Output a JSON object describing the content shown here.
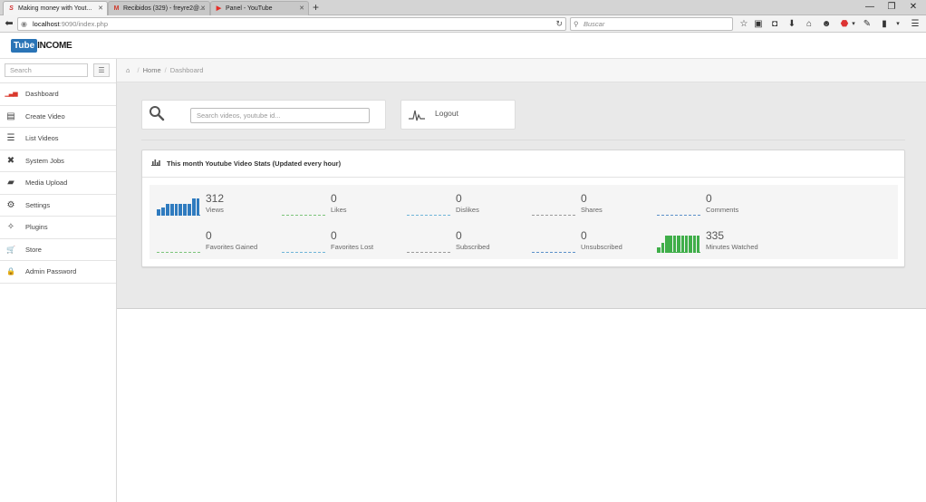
{
  "browser": {
    "tabs": [
      {
        "title": "Making money with Yout...",
        "favicon": "S",
        "active": true
      },
      {
        "title": "Recibidos (329) - freyre2@...",
        "favicon": "M",
        "active": false
      },
      {
        "title": "Panel - YouTube",
        "favicon": "▶",
        "active": false
      }
    ],
    "url_host": "localhost",
    "url_path": ":9090/index.php",
    "search_placeholder": "Buscar"
  },
  "app": {
    "logo_tube": "Tube",
    "logo_income": "INCOME"
  },
  "sidebar": {
    "search_placeholder": "Search",
    "items": [
      {
        "label": "Dashboard",
        "icon": "bar-chart-icon",
        "glyph": "▁▃▅",
        "active": true
      },
      {
        "label": "Create Video",
        "icon": "film-icon",
        "glyph": "▤"
      },
      {
        "label": "List Videos",
        "icon": "list-icon",
        "glyph": "☰"
      },
      {
        "label": "System Jobs",
        "icon": "tools-icon",
        "glyph": "✖"
      },
      {
        "label": "Media Upload",
        "icon": "folder-icon",
        "glyph": "▰"
      },
      {
        "label": "Settings",
        "icon": "gears-icon",
        "glyph": "⚙"
      },
      {
        "label": "Plugins",
        "icon": "magic-icon",
        "glyph": "✧"
      },
      {
        "label": "Store",
        "icon": "cart-icon",
        "glyph": "🛒"
      },
      {
        "label": "Admin Password",
        "icon": "lock-icon",
        "glyph": "🔒"
      }
    ]
  },
  "breadcrumb": {
    "home": "Home",
    "current": "Dashboard"
  },
  "search": {
    "placeholder": "Search videos, youtube id..."
  },
  "logout": {
    "label": "Logout"
  },
  "stats": {
    "title": "This month Youtube Video Stats (Updated every hour)",
    "items": [
      {
        "value": "312",
        "label": "Views",
        "color": "#2f7bbf",
        "bars": [
          0.35,
          0.45,
          0.65,
          0.65,
          0.65,
          0.65,
          0.65,
          0.65,
          0.95,
          0.95
        ]
      },
      {
        "value": "0",
        "label": "Likes",
        "color": "#7cc47a",
        "bars": []
      },
      {
        "value": "0",
        "label": "Dislikes",
        "color": "#6fb4d8",
        "bars": []
      },
      {
        "value": "0",
        "label": "Shares",
        "color": "#9a9a9a",
        "bars": []
      },
      {
        "value": "0",
        "label": "Comments",
        "color": "#5b90c9",
        "bars": []
      },
      {
        "value": "0",
        "label": "Favorites Gained",
        "color": "#7cc47a",
        "bars": []
      },
      {
        "value": "0",
        "label": "Favorites Lost",
        "color": "#6fb4d8",
        "bars": []
      },
      {
        "value": "0",
        "label": "Subscribed",
        "color": "#9a9a9a",
        "bars": []
      },
      {
        "value": "0",
        "label": "Unsubscribed",
        "color": "#5b90c9",
        "bars": []
      },
      {
        "value": "335",
        "label": "Minutes Watched",
        "color": "#3fae49",
        "bars": [
          0.3,
          0.55,
          0.95,
          0.95,
          0.95,
          0.95,
          0.95,
          0.95,
          0.95,
          0.95,
          0.95
        ]
      }
    ]
  }
}
